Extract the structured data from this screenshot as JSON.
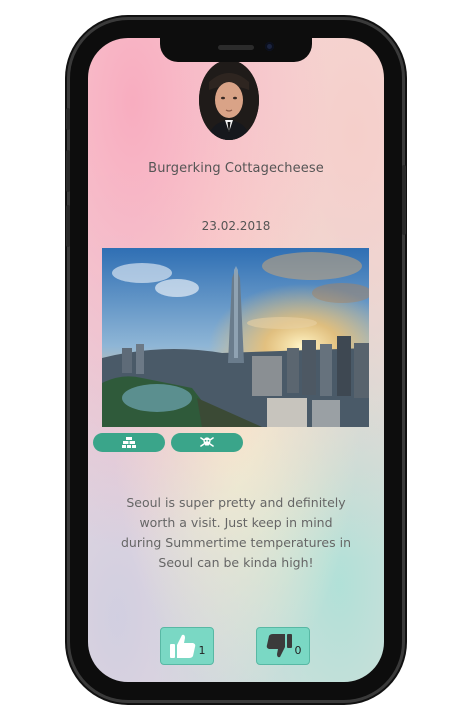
{
  "post": {
    "author": "Burgerking Cottagecheese",
    "date": "23.02.2018",
    "description": "Seoul is super pretty and definitely worth a visit. Just keep in mind during Summertime temperatures in Seoul can be kinda high!",
    "avatar_icon": "profile-photo",
    "photo_icon": "seoul-city-skyline-photo"
  },
  "tags": [
    {
      "icon": "bricks-icon"
    },
    {
      "icon": "skull-crossbones-icon"
    }
  ],
  "votes": {
    "likes": "1",
    "dislikes": "0",
    "like_icon": "thumbs-up-icon",
    "dislike_icon": "thumbs-down-icon"
  },
  "colors": {
    "accent": "#3aa58a",
    "vote_button": "#7ad8c4",
    "text": "#555555"
  }
}
